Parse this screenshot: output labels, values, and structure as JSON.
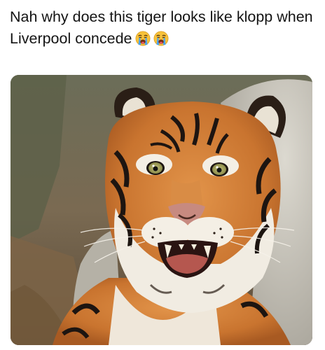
{
  "post": {
    "caption": "Nah why does this tiger looks like klopp when Liverpool concede",
    "emojis": [
      "loudly-crying-face",
      "loudly-crying-face"
    ]
  },
  "media": {
    "subject": "tiger",
    "colors": {
      "background": "#6f6a55",
      "rock": "#c9c6bd",
      "fur_orange": "#d7843a",
      "stripe": "#1d1511",
      "fur_white": "#f1ece2"
    }
  }
}
